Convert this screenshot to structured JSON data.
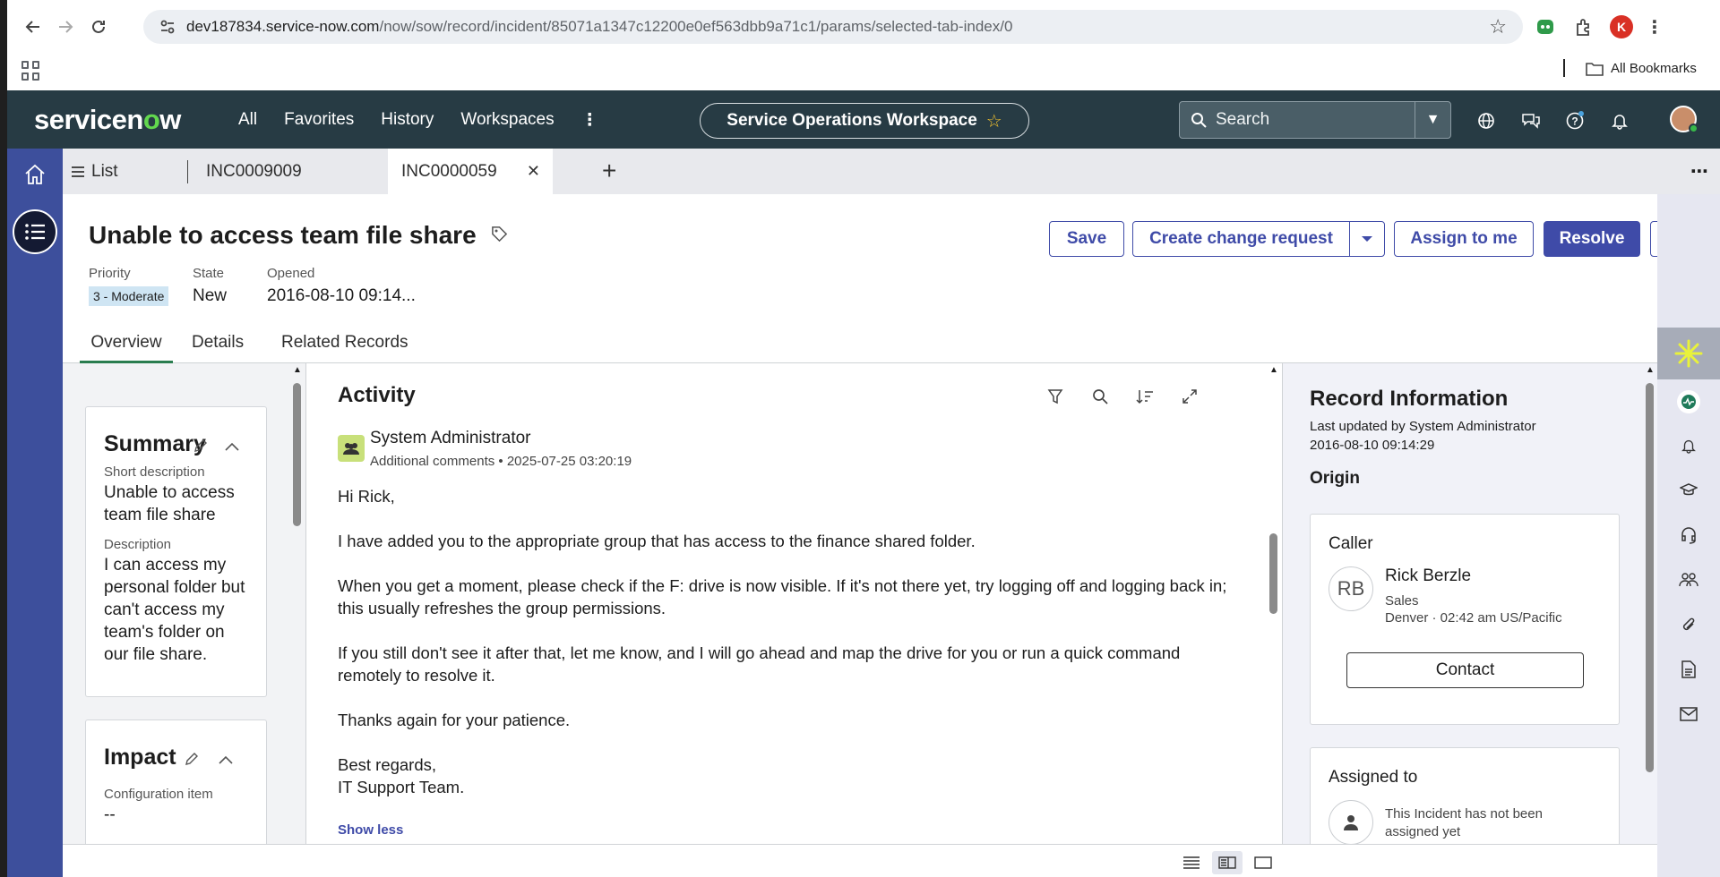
{
  "browser": {
    "url_host": "dev187834.service-now.com",
    "url_path": "/now/sow/record/incident/85071a1347c12200e0ef563dbb9a71c1/params/selected-tab-index/0",
    "profile_initial": "K",
    "bookmarks_label": "All Bookmarks"
  },
  "header": {
    "logo_pre": "servicen",
    "logo_o": "o",
    "logo_post": "w",
    "nav": [
      "All",
      "Favorites",
      "History",
      "Workspaces"
    ],
    "more": "⋮",
    "workspace": "Service Operations Workspace",
    "search_placeholder": "Search"
  },
  "tabs": {
    "list_label": "List",
    "tab1": "INC0009009",
    "tab2": "INC0000059",
    "add": "+",
    "more": "⋯"
  },
  "record": {
    "title": "Unable to access team file share",
    "priority_label": "Priority",
    "priority_value": "3 - Moderate",
    "state_label": "State",
    "state_value": "New",
    "opened_label": "Opened",
    "opened_value": "2016-08-10 09:14..."
  },
  "actions": {
    "save": "Save",
    "create_change": "Create change request",
    "assign_to_me": "Assign to me",
    "resolve": "Resolve",
    "more": "⋯"
  },
  "subtabs": [
    "Overview",
    "Details",
    "Related Records"
  ],
  "summary": {
    "title": "Summary",
    "short_desc_label": "Short description",
    "short_desc_value": "Unable to access team file share",
    "desc_label": "Description",
    "desc_value": "I can access my personal folder but can't access my team's folder on our file share."
  },
  "impact": {
    "title": "Impact",
    "ci_label": "Configuration item",
    "ci_value": "--"
  },
  "activity": {
    "title": "Activity",
    "author": "System Administrator",
    "entry_type": "Additional comments",
    "entry_sep": "•",
    "timestamp": "2025-07-25 03:20:19",
    "body": [
      "Hi Rick,",
      "I have added you to the appropriate group that has access to the finance shared folder.",
      "When you get a moment, please check if the F: drive is now visible. If it's not there yet, try logging off and logging back in; this usually refreshes the group permissions.",
      "If you still don't see it after that, let me know, and I will go ahead and map the drive for you or run a quick command remotely to resolve it.",
      "Thanks again for your patience.",
      "Best regards,",
      "IT Support Team."
    ],
    "show_less": "Show less"
  },
  "record_info": {
    "title": "Record Information",
    "updated_by": "Last updated by System Administrator",
    "updated_at": "2016-08-10 09:14:29",
    "origin": "Origin",
    "caller_label": "Caller",
    "caller_initials": "RB",
    "caller_name": "Rick Berzle",
    "caller_dept": "Sales",
    "caller_location": "Denver · 02:42 am US/Pacific",
    "contact": "Contact",
    "assigned_label": "Assigned to",
    "assigned_value": "This Incident has not been assigned yet"
  },
  "colors": {
    "header_bg": "#273b44",
    "left_rail_bg": "#3d4f9c",
    "primary": "#3f4ba8",
    "logo_green": "#62d84e",
    "priority_badge": "#cfe5f3",
    "active_subtab": "#2a7d4f"
  },
  "icons": [
    "back-icon",
    "forward-icon",
    "reload-icon",
    "site-info-icon",
    "bookmark-star-icon",
    "extension-icon",
    "apps-icon",
    "folder-icon",
    "globe-icon",
    "chat-icon",
    "help-icon",
    "bell-icon",
    "home-icon",
    "list-icon",
    "tag-icon",
    "filter-icon",
    "search-icon",
    "sort-icon",
    "expand-icon",
    "group-icon",
    "edit-icon",
    "collapse-icon",
    "sparkle-icon",
    "pulse-icon",
    "graduation-icon",
    "headset-icon",
    "people-icon",
    "paperclip-icon",
    "document-icon",
    "envelope-icon",
    "user-icon"
  ]
}
